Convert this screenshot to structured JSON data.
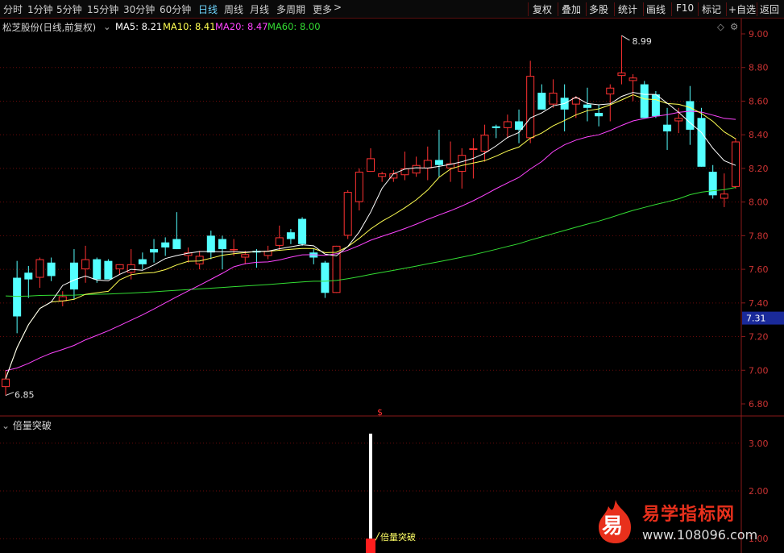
{
  "toolbar": {
    "periods": [
      "分时",
      "1分钟",
      "5分钟",
      "15分钟",
      "30分钟",
      "60分钟",
      "日线",
      "周线",
      "月线",
      "多周期",
      "更多"
    ],
    "active_period": "日线",
    "buttons": [
      "复权",
      "叠加",
      "多股",
      "统计",
      "画线",
      "F10",
      "标记",
      "+自选",
      "返回"
    ]
  },
  "info": {
    "title": "松芝股份(日线,前复权)",
    "ma5": "MA5: 8.21",
    "ma10": "MA10: 8.41",
    "ma20": "MA20: 8.47",
    "ma60": "MA60: 8.00"
  },
  "colors": {
    "up": "#ff3232",
    "down": "#54ffff",
    "ma5": "#ffffff",
    "ma10": "#ffff52",
    "ma20": "#ff44ff",
    "ma60": "#33dd33",
    "price_tag_bg": "#1a2a9a",
    "grid": "#6a0a0a"
  },
  "chart_data": [
    {
      "type": "candlestick",
      "ylim": [
        6.8,
        9.0
      ],
      "y_ticks": [
        "9.00",
        "8.80",
        "8.60",
        "8.40",
        "8.20",
        "8.00",
        "7.80",
        "7.60",
        "7.40",
        "7.20",
        "7.00",
        "6.80"
      ],
      "current_price_tag": "7.31",
      "high_label": "8.99",
      "low_label": "6.85",
      "candles": [
        [
          6.9,
          7.0,
          6.85,
          6.95
        ],
        [
          7.55,
          7.65,
          7.22,
          7.32
        ],
        [
          7.58,
          7.62,
          7.43,
          7.54
        ],
        [
          7.55,
          7.67,
          7.49,
          7.66
        ],
        [
          7.64,
          7.67,
          7.53,
          7.56
        ],
        [
          7.41,
          7.47,
          7.38,
          7.44
        ],
        [
          7.64,
          7.72,
          7.42,
          7.48
        ],
        [
          7.6,
          7.74,
          7.52,
          7.66
        ],
        [
          7.66,
          7.67,
          7.52,
          7.54
        ],
        [
          7.65,
          7.66,
          7.58,
          7.54
        ],
        [
          7.6,
          7.63,
          7.57,
          7.63
        ],
        [
          7.58,
          7.72,
          7.54,
          7.63
        ],
        [
          7.66,
          7.7,
          7.6,
          7.63
        ],
        [
          7.72,
          7.78,
          7.64,
          7.7
        ],
        [
          7.76,
          7.79,
          7.68,
          7.73
        ],
        [
          7.78,
          7.94,
          7.72,
          7.72
        ],
        [
          7.68,
          7.73,
          7.64,
          7.7
        ],
        [
          7.63,
          7.71,
          7.6,
          7.68
        ],
        [
          7.8,
          7.83,
          7.66,
          7.7
        ],
        [
          7.78,
          7.8,
          7.6,
          7.72
        ],
        [
          7.72,
          7.78,
          7.68,
          7.72
        ],
        [
          7.67,
          7.71,
          7.63,
          7.69
        ],
        [
          7.71,
          7.72,
          7.61,
          7.7
        ],
        [
          7.68,
          7.74,
          7.66,
          7.71
        ],
        [
          7.74,
          7.86,
          7.71,
          7.79
        ],
        [
          7.82,
          7.84,
          7.75,
          7.78
        ],
        [
          7.9,
          7.91,
          7.74,
          7.75
        ],
        [
          7.7,
          7.72,
          7.63,
          7.67
        ],
        [
          7.64,
          7.65,
          7.43,
          7.46
        ],
        [
          7.46,
          7.74,
          7.46,
          7.74
        ],
        [
          7.8,
          8.07,
          7.78,
          8.06
        ],
        [
          8.0,
          8.2,
          7.95,
          8.18
        ],
        [
          8.18,
          8.32,
          8.18,
          8.26
        ],
        [
          8.15,
          8.18,
          8.12,
          8.17
        ],
        [
          8.14,
          8.19,
          8.12,
          8.17
        ],
        [
          8.16,
          8.3,
          8.13,
          8.2
        ],
        [
          8.17,
          8.27,
          8.15,
          8.22
        ],
        [
          8.2,
          8.33,
          8.13,
          8.25
        ],
        [
          8.25,
          8.43,
          8.15,
          8.22
        ],
        [
          8.2,
          8.36,
          8.12,
          8.23
        ],
        [
          8.18,
          8.32,
          8.08,
          8.28
        ],
        [
          8.31,
          8.38,
          8.14,
          8.32
        ],
        [
          8.3,
          8.46,
          8.24,
          8.4
        ],
        [
          8.45,
          8.46,
          8.38,
          8.44
        ],
        [
          8.44,
          8.52,
          8.38,
          8.48
        ],
        [
          8.48,
          8.55,
          8.35,
          8.43
        ],
        [
          8.38,
          8.84,
          8.35,
          8.75
        ],
        [
          8.65,
          8.7,
          8.55,
          8.55
        ],
        [
          8.58,
          8.73,
          8.56,
          8.65
        ],
        [
          8.62,
          8.7,
          8.42,
          8.55
        ],
        [
          8.58,
          8.63,
          8.5,
          8.62
        ],
        [
          8.58,
          8.68,
          8.48,
          8.56
        ],
        [
          8.53,
          8.58,
          8.45,
          8.51
        ],
        [
          8.64,
          8.7,
          8.48,
          8.68
        ],
        [
          8.75,
          8.99,
          8.7,
          8.77
        ],
        [
          8.72,
          8.76,
          8.6,
          8.74
        ],
        [
          8.7,
          8.72,
          8.55,
          8.5
        ],
        [
          8.64,
          8.66,
          8.5,
          8.51
        ],
        [
          8.46,
          8.56,
          8.31,
          8.42
        ],
        [
          8.48,
          8.56,
          8.41,
          8.5
        ],
        [
          8.6,
          8.69,
          8.34,
          8.43
        ],
        [
          8.5,
          8.56,
          8.21,
          8.21
        ],
        [
          8.18,
          8.22,
          8.02,
          8.04
        ],
        [
          8.02,
          8.17,
          7.97,
          8.05
        ],
        [
          8.09,
          8.38,
          8.08,
          8.36
        ]
      ]
    },
    {
      "type": "bar",
      "title": "倍量突破",
      "ylim": [
        0.7,
        3.3
      ],
      "y_ticks": [
        "3.00",
        "2.00",
        "1.00"
      ],
      "signal_label": "倍量突破",
      "signal_bar": {
        "index": 29,
        "white_from": 1.0,
        "white_to": 3.2,
        "red_to": 1.0
      }
    }
  ],
  "marker_symbol": "$",
  "logo": {
    "title": "易学指标网",
    "url": "www.108096.com",
    "badge_char": "易"
  }
}
